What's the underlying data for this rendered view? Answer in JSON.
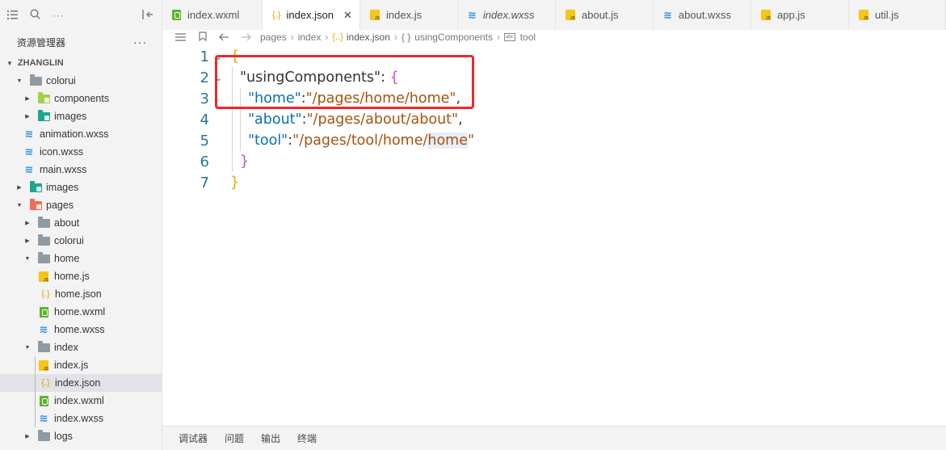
{
  "sidebar": {
    "title": "资源管理器",
    "more": "···",
    "root": "ZHANGLIN",
    "tree": [
      {
        "label": "colorui",
        "type": "folder-open",
        "color": "gray",
        "depth": 1
      },
      {
        "label": "components",
        "type": "folder",
        "color": "lime",
        "depth": 2
      },
      {
        "label": "images",
        "type": "folder",
        "color": "teal",
        "depth": 2
      },
      {
        "label": "animation.wxss",
        "type": "wxss",
        "depth": 2
      },
      {
        "label": "icon.wxss",
        "type": "wxss",
        "depth": 2
      },
      {
        "label": "main.wxss",
        "type": "wxss",
        "depth": 2
      },
      {
        "label": "images",
        "type": "folder",
        "color": "teal",
        "depth": 1
      },
      {
        "label": "pages",
        "type": "folder-open",
        "color": "red",
        "depth": 1
      },
      {
        "label": "about",
        "type": "folder",
        "color": "gray",
        "depth": 2
      },
      {
        "label": "colorui",
        "type": "folder",
        "color": "gray",
        "depth": 2
      },
      {
        "label": "home",
        "type": "folder-open",
        "color": "gray",
        "depth": 2
      },
      {
        "label": "home.js",
        "type": "js",
        "depth": 3
      },
      {
        "label": "home.json",
        "type": "json",
        "depth": 3
      },
      {
        "label": "home.wxml",
        "type": "wxml",
        "depth": 3
      },
      {
        "label": "home.wxss",
        "type": "wxss",
        "depth": 3
      },
      {
        "label": "index",
        "type": "folder-open",
        "color": "gray",
        "depth": 2
      },
      {
        "label": "index.js",
        "type": "js",
        "depth": 3
      },
      {
        "label": "index.json",
        "type": "json",
        "depth": 3,
        "selected": true
      },
      {
        "label": "index.wxml",
        "type": "wxml",
        "depth": 3
      },
      {
        "label": "index.wxss",
        "type": "wxss",
        "depth": 3
      },
      {
        "label": "logs",
        "type": "folder",
        "color": "gray",
        "depth": 2
      }
    ]
  },
  "tabs": [
    {
      "label": "index.wxml",
      "icon": "wxml"
    },
    {
      "label": "index.json",
      "icon": "json",
      "active": true,
      "close": "✕"
    },
    {
      "label": "index.js",
      "icon": "js"
    },
    {
      "label": "index.wxss",
      "icon": "wxss",
      "italic": true
    },
    {
      "label": "about.js",
      "icon": "js"
    },
    {
      "label": "about.wxss",
      "icon": "wxss"
    },
    {
      "label": "app.js",
      "icon": "js"
    },
    {
      "label": "util.js",
      "icon": "js"
    }
  ],
  "breadcrumb": {
    "segments": [
      "pages",
      "index",
      "index.json",
      "usingComponents",
      "tool"
    ],
    "json_icon": "{..}",
    "obj_icon": "{ }",
    "str_icon": "abc"
  },
  "editor": {
    "line_numbers": [
      "1",
      "2",
      "3",
      "4",
      "5",
      "6",
      "7"
    ],
    "lines": {
      "l1_open": "{",
      "l2_key": "\"usingComponents\"",
      "l2_colon": ": ",
      "l2_open": "{",
      "l3_key": "\"home\"",
      "l3_val": "\"/pages/home/home\"",
      "l4_key": "\"about\"",
      "l4_val": "\"/pages/about/about\"",
      "l5_key": "\"tool\"",
      "l5_val_a": "\"/pages/tool/home/",
      "l5_val_b": "home",
      "l5_val_c": "\"",
      "l6_close": "}",
      "l7_close": "}"
    },
    "annotation_color": "#ee2727"
  },
  "bottom_panel": {
    "tabs": [
      "调试器",
      "问题",
      "输出",
      "终端"
    ]
  }
}
